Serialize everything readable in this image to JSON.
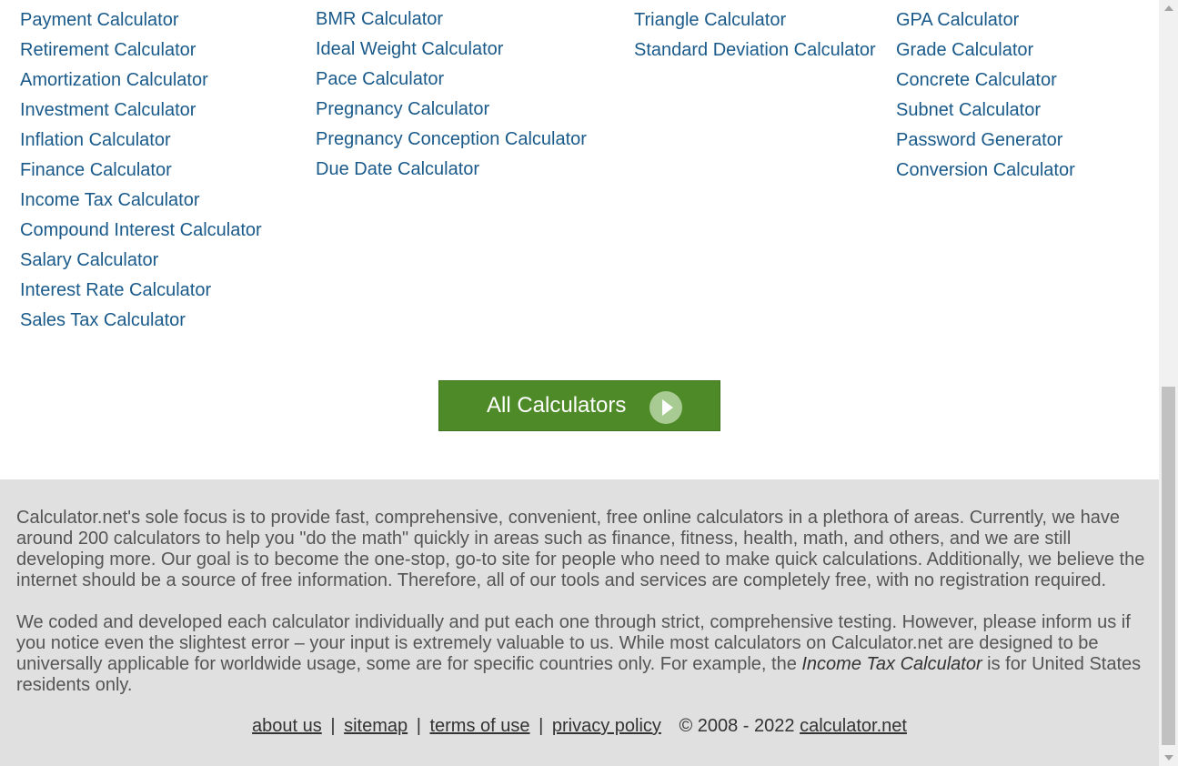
{
  "columns": {
    "financial": [
      "Payment Calculator",
      "Retirement Calculator",
      "Amortization Calculator",
      "Investment Calculator",
      "Inflation Calculator",
      "Finance Calculator",
      "Income Tax Calculator",
      "Compound Interest Calculator",
      "Salary Calculator",
      "Interest Rate Calculator",
      "Sales Tax Calculator"
    ],
    "fitness": [
      "BMR Calculator",
      "Ideal Weight Calculator",
      "Pace Calculator",
      "Pregnancy Calculator",
      "Pregnancy Conception Calculator",
      "Due Date Calculator"
    ],
    "math": [
      "Triangle Calculator",
      "Standard Deviation Calculator"
    ],
    "other": [
      "GPA Calculator",
      "Grade Calculator",
      "Concrete Calculator",
      "Subnet Calculator",
      "Password Generator",
      "Conversion Calculator"
    ]
  },
  "all_button": {
    "label": "All Calculators",
    "icon": "play-arrow-circle-icon"
  },
  "footer": {
    "paragraph1": "Calculator.net's sole focus is to provide fast, comprehensive, convenient, free online calculators in a plethora of areas. Currently, we have around 200 calculators to help you \"do the math\" quickly in areas such as finance, fitness, health, math, and others, and we are still developing more. Our goal is to become the one-stop, go-to site for people who need to make quick calculations. Additionally, we believe the internet should be a source of free information. Therefore, all of our tools and services are completely free, with no registration required.",
    "paragraph2_before": "We coded and developed each calculator individually and put each one through strict, comprehensive testing. However, please inform us if you notice even the slightest error – your input is extremely valuable to us. While most calculators on Calculator.net are designed to be universally applicable for worldwide usage, some are for specific countries only. For example, the ",
    "paragraph2_emphasis": "Income Tax Calculator",
    "paragraph2_after": " is for United States residents only.",
    "links": {
      "about": "about us",
      "sitemap": "sitemap",
      "terms": "terms of use",
      "privacy": "privacy policy",
      "separator": "|"
    },
    "copyright": "© 2008 - 2022",
    "site_link": "calculator.net"
  },
  "colors": {
    "link": "#1a5a8a",
    "button_bg": "#4e8a28",
    "footer_bg": "#e0e0e0"
  }
}
